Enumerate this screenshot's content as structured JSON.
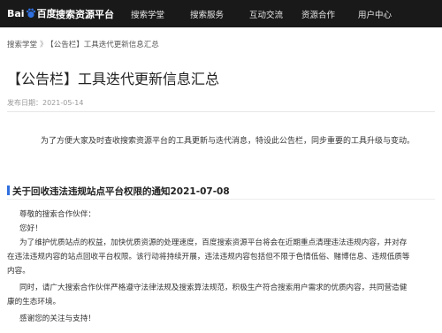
{
  "header": {
    "logo_text_left": "Bai",
    "logo_text_right": "百度",
    "brand": "搜索资源平台",
    "nav": [
      "搜索学堂",
      "搜索服务",
      "互动交流",
      "资源合作",
      "用户中心"
    ]
  },
  "breadcrumb": {
    "home": "搜索学堂",
    "separator": "》",
    "current": "【公告栏】工具迭代更新信息汇总"
  },
  "article": {
    "title": "【公告栏】工具迭代更新信息汇总",
    "publish_date": "发布日期：2021-05-14",
    "intro": "为了方便大家及时查收搜索资源平台的工具更新与迭代消息，特设此公告栏，同步重要的工具升级与变动。",
    "section_title": "关于回收违法违规站点平台权限的通知2021-07-08",
    "greeting": "尊敬的搜索合作伙伴：",
    "hello": "您好！",
    "p1_line1": "为了维护优质站点的权益，加快优质资源的处理速度，百度搜索资源平台将会在近期重点清理违法违规内容，并对存",
    "p1_line2": "在违法违规内容的站点回收平台权限。该行动将持续开展，违法违规内容包括但不限于色情低俗、赌博信息、违规低质等",
    "p1_line3": "内容。",
    "p2_line1": "同时，请广大搜索合作伙伴严格遵守法律法规及搜索算法规范，积极生产符合搜索用户需求的优质内容，共同营造健",
    "p2_line2": "康的生态环境。",
    "thanks": "感谢您的关注与支持！"
  },
  "colors": {
    "topbar": "#191919",
    "accent": "#2f6fde"
  }
}
